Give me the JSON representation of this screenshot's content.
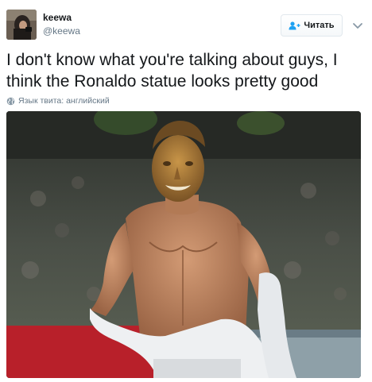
{
  "author": {
    "display_name": "keewa",
    "handle": "@keewa",
    "avatar_icon": "profile-photo"
  },
  "follow_button": {
    "label": "Читать",
    "icon": "add-user-icon",
    "color": "#1da1f2"
  },
  "menu_icon": "chevron-down-icon",
  "tweet": {
    "text": "I don't know what you're talking about guys, I think the Ronaldo statue looks pretty good",
    "language_label": "Язык твита: английский",
    "language_icon": "globe-icon"
  },
  "media": {
    "type": "photo",
    "subject": "shirtless football player with bronze statue face in a stadium"
  },
  "colors": {
    "text": "#14171a",
    "secondary": "#657786",
    "border": "#e1e8ed",
    "accent": "#1da1f2"
  }
}
